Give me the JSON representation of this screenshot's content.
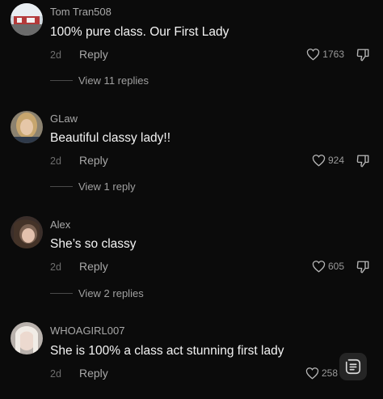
{
  "colors": {
    "background": "#0b0b0b",
    "text": "#f4f4f4",
    "muted": "#a8a8a8"
  },
  "comments": [
    {
      "username": "Tom Tran508",
      "text": "100% pure class. Our First Lady",
      "time": "2d",
      "reply_label": "Reply",
      "likes": "1763",
      "view_replies": "View 11 replies",
      "like_icon": "heart-icon",
      "dislike_icon": "thumbs-down-icon"
    },
    {
      "username": "GLaw",
      "text": "Beautiful classy lady!!",
      "time": "2d",
      "reply_label": "Reply",
      "likes": "924",
      "view_replies": "View 1 reply",
      "like_icon": "heart-icon",
      "dislike_icon": "thumbs-down-icon"
    },
    {
      "username": "Alex",
      "text": "She’s so classy",
      "time": "2d",
      "reply_label": "Reply",
      "likes": "605",
      "view_replies": "View 2 replies",
      "like_icon": "heart-icon",
      "dislike_icon": "thumbs-down-icon"
    },
    {
      "username": "WHOAGIRL007",
      "text": "She is 100% a class act stunning first lady",
      "time": "2d",
      "reply_label": "Reply",
      "likes": "258",
      "like_icon": "heart-icon"
    }
  ],
  "floating_button_icon": "list-menu-icon"
}
